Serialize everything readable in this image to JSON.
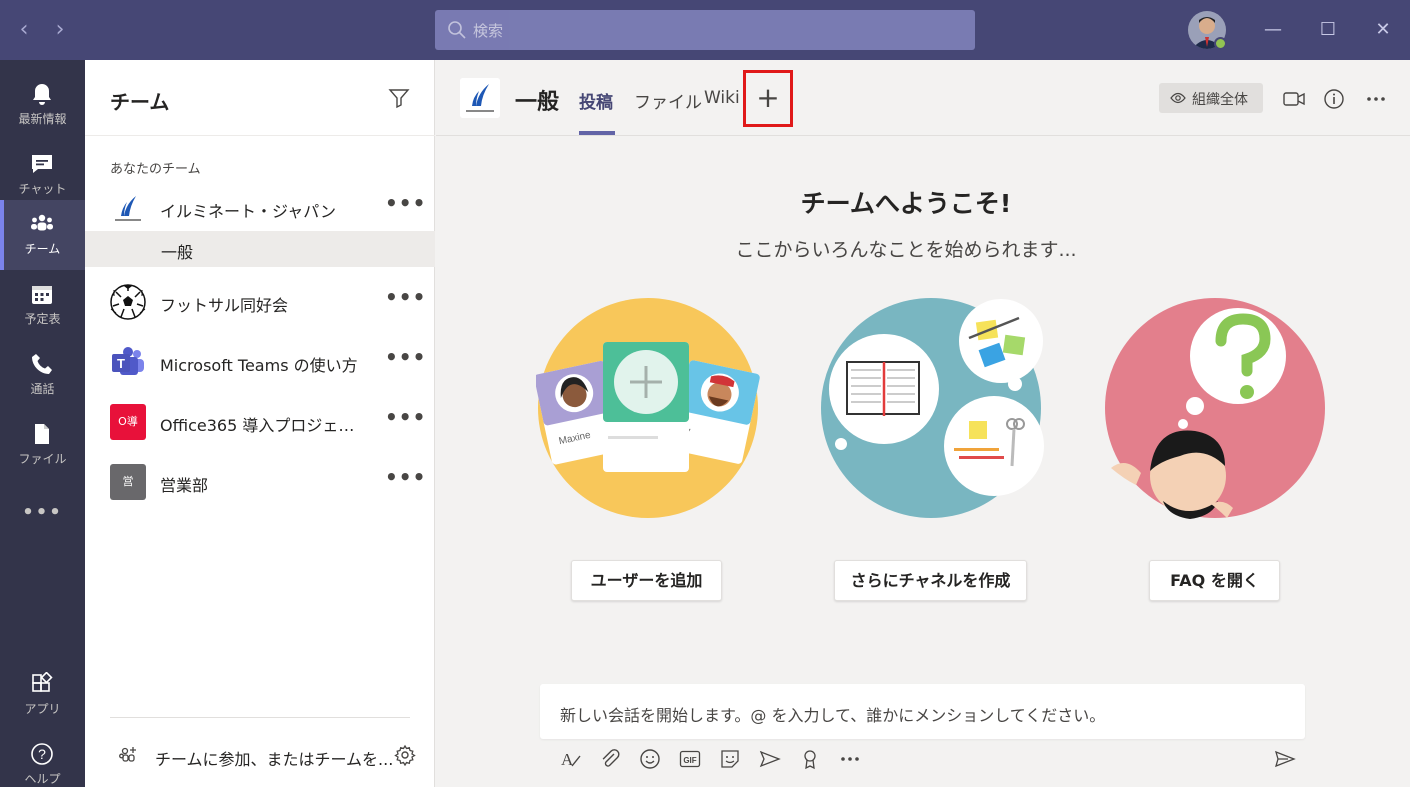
{
  "titlebar": {
    "search_placeholder": "検索",
    "back_icon": "chevron-left-icon",
    "forward_icon": "chevron-right-icon"
  },
  "rail": {
    "items": [
      {
        "label": "最新情報",
        "icon": "bell-icon"
      },
      {
        "label": "チャット",
        "icon": "chat-icon"
      },
      {
        "label": "チーム",
        "icon": "teams-icon",
        "active": true
      },
      {
        "label": "予定表",
        "icon": "calendar-icon"
      },
      {
        "label": "通話",
        "icon": "phone-icon"
      },
      {
        "label": "ファイル",
        "icon": "file-icon"
      },
      {
        "label": "...",
        "icon": "more-icon"
      },
      {
        "label": "アプリ",
        "icon": "apps-icon"
      },
      {
        "label": "ヘルプ",
        "icon": "help-icon"
      }
    ],
    "more_label": "•••"
  },
  "pane": {
    "title": "チーム",
    "section_label": "あなたのチーム",
    "teams": [
      {
        "name": "イルミネート・ジャパン",
        "logo": "illuminate-logo"
      },
      {
        "name": "フットサル同好会",
        "logo": "soccer-ball-icon"
      },
      {
        "name": "Microsoft Teams の使い方",
        "logo": "teams-logo"
      },
      {
        "name": "Office365 導入プロジェクト...",
        "logo_text": "O導",
        "logo_color": "#e8113a"
      },
      {
        "name": "営業部",
        "logo_text": "営",
        "logo_color": "#69686b"
      }
    ],
    "active_channel": "一般",
    "more_label": "•••",
    "join_label": "チームに参加、またはチームを..."
  },
  "header": {
    "channel_title": "一般",
    "tabs": [
      {
        "label": "投稿",
        "active": true
      },
      {
        "label": "ファイル"
      },
      {
        "label": "Wiki"
      }
    ],
    "add_tab_label": "+",
    "org_label": "組織全体"
  },
  "welcome": {
    "title": "チームへようこそ!",
    "subtitle": "ここからいろんなことを始められます...",
    "card_names": [
      "Maxine",
      "ky"
    ],
    "buttons": {
      "add_user": "ユーザーを追加",
      "create_channel": "さらにチャネルを作成",
      "open_faq": "FAQ を開く"
    }
  },
  "compose": {
    "placeholder": "新しい会話を開始します。@ を入力して、誰かにメンションしてください。",
    "toolbar_more": "•••",
    "gif_label": "GIF"
  },
  "colors": {
    "titlebar": "#464775",
    "rail": "#33344a",
    "accent": "#6264a7",
    "highlight_box": "#e0191a"
  }
}
